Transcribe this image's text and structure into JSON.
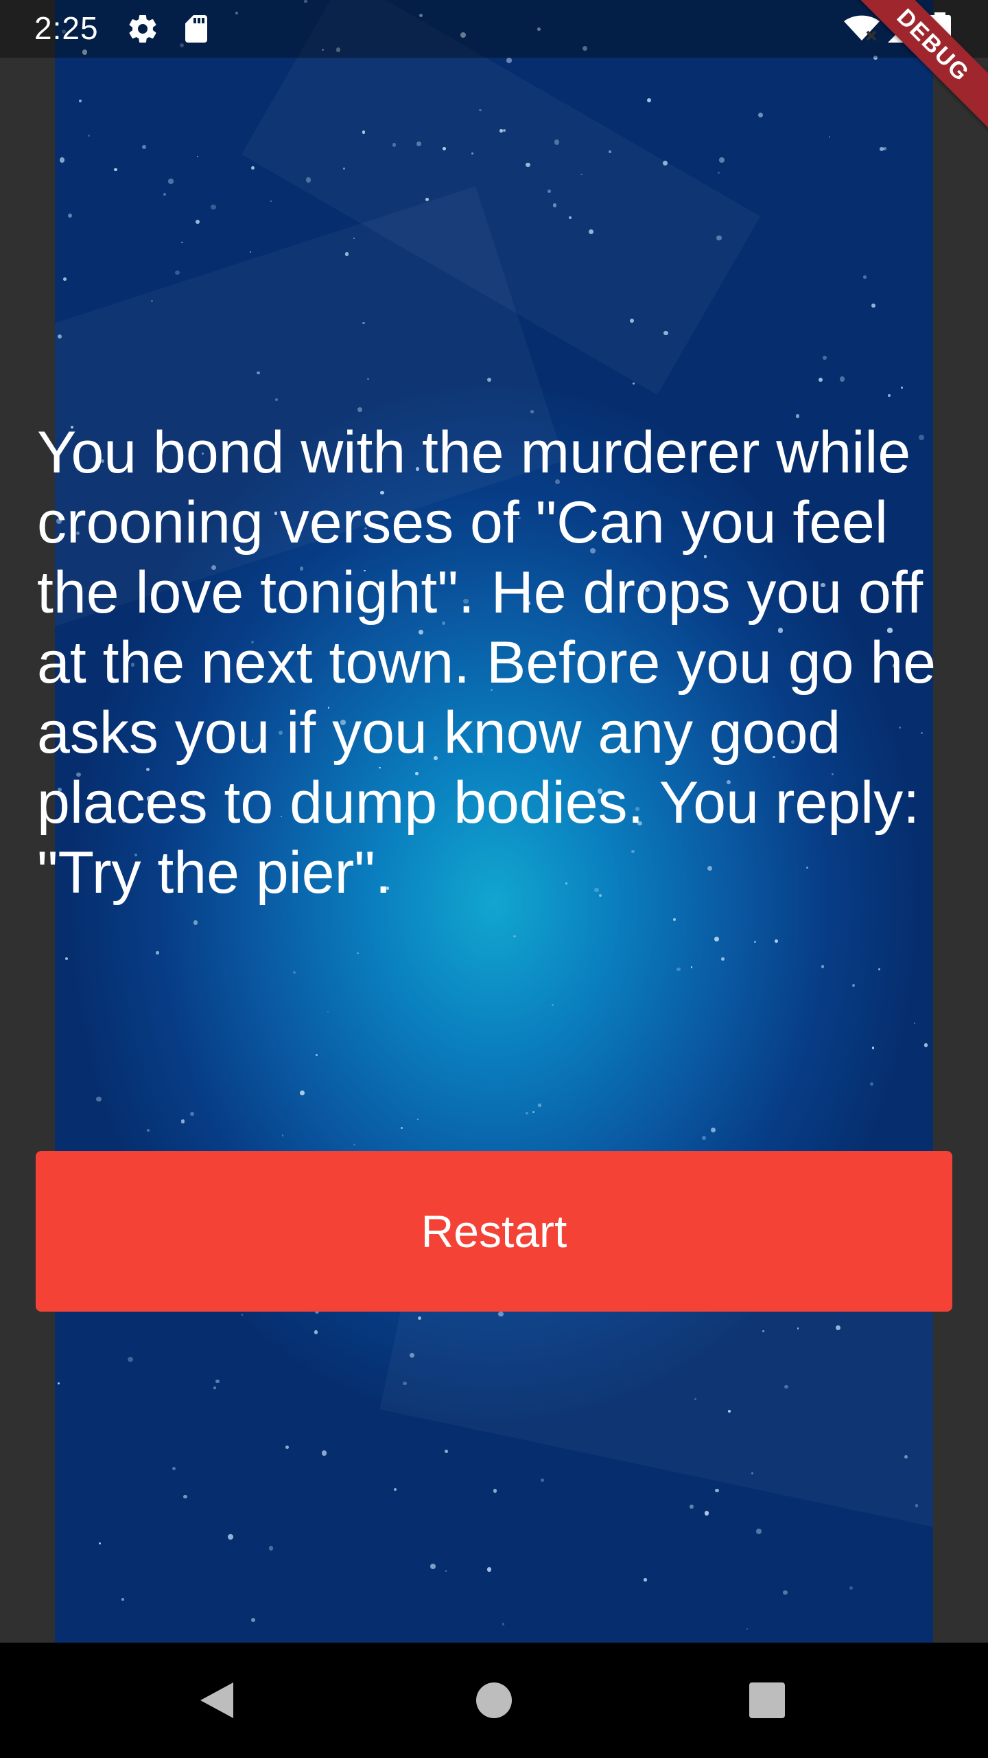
{
  "status_bar": {
    "time": "2:25",
    "icons": [
      "settings-icon",
      "sd-card-icon",
      "wifi-off-icon",
      "signal-icon",
      "battery-icon"
    ]
  },
  "debug_banner": {
    "label": "DEBUG",
    "color": "#a0262e"
  },
  "story": {
    "text": "You bond with the murderer while crooning verses of \"Can you feel the love tonight\". He drops you off at the next town. Before you go he asks you if you know any good places to dump bodies. You reply: \"Try the pier\"."
  },
  "actions": {
    "restart_label": "Restart",
    "restart_color": "#f44336"
  },
  "nav_bar": {
    "icons": [
      "back-icon",
      "home-icon",
      "recents-icon"
    ]
  }
}
